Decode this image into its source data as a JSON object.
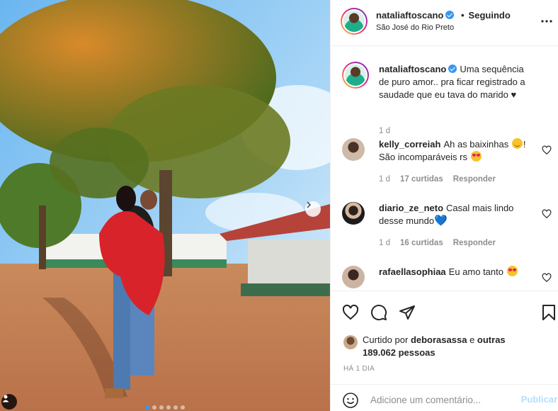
{
  "post": {
    "author": "nataliaftoscano",
    "follow_status": "Seguindo",
    "separator": "•",
    "location": "São José do Rio Preto",
    "caption": "Uma sequência de puro amor.. pra ficar registrado a saudade que eu tava do marido ♥",
    "caption_age": "1 d",
    "carousel": {
      "slides": 6,
      "active_index": 0
    }
  },
  "comments": [
    {
      "user": "kelly_correiah",
      "text_before": "Ah as baixinhas",
      "emoji1": "smiling-face-icon",
      "text_mid": "! São incomparáveis rs",
      "emoji2": "heart-eyes-icon",
      "age": "1 d",
      "likes": "17 curtidas",
      "reply": "Responder"
    },
    {
      "user": "diario_ze_neto",
      "text_before": "Casal mais lindo desse mundo",
      "emoji1": "blue-heart-icon",
      "emoji_glyph": "💙",
      "age": "1 d",
      "likes": "16 curtidas",
      "reply": "Responder"
    },
    {
      "user": "rafaellasophiaa",
      "text_before": "Eu amo tanto",
      "emoji1": "heart-eyes-icon"
    }
  ],
  "likes": {
    "prefix": "Curtido por",
    "user": "deborasassa",
    "conj": "e",
    "others": "outras 189.062 pessoas"
  },
  "timestamp": "HÁ 1 DIA",
  "add_comment": {
    "placeholder": "Adicione um comentário...",
    "submit_label": "Publicar"
  },
  "colors": {
    "verified": "#3897f0",
    "publish_disabled": "#b2dffc",
    "muted_text": "#8e8e8e"
  }
}
